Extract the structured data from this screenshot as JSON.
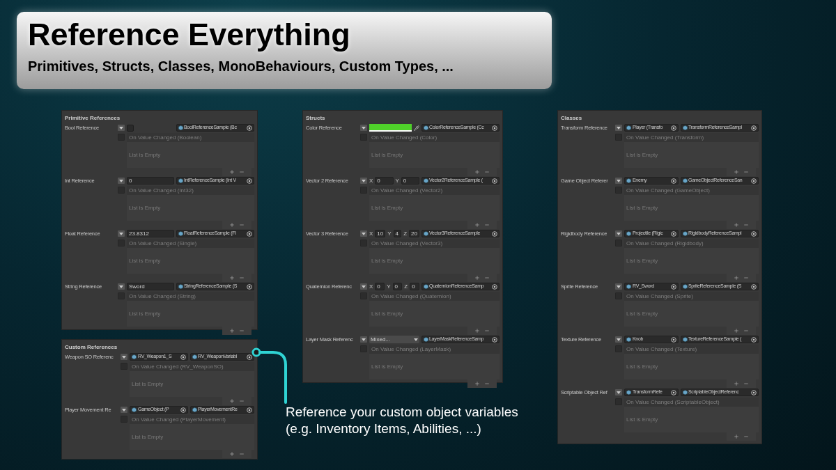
{
  "header": {
    "title": "Reference Everything",
    "subtitle": "Primitives, Structs, Classes, MonoBehaviours, Custom Types, ..."
  },
  "columns": [
    {
      "panels": [
        {
          "title": "Primitive References",
          "entries": [
            {
              "label": "Bool Reference",
              "kind": "bool",
              "checked": false,
              "reference": "BoolReferenceSample (Bc",
              "event": "On Value Changed (Boolean)",
              "empty_text": "List is Empty"
            },
            {
              "label": "Int Reference",
              "kind": "value",
              "value": "0",
              "reference": "IntReferenceSample (Int V",
              "event": "On Value Changed (Int32)",
              "empty_text": "List is Empty"
            },
            {
              "label": "Float Reference",
              "kind": "value",
              "value": "23.8312",
              "reference": "FloatReferenceSample (Fl",
              "event": "On Value Changed (Single)",
              "empty_text": "List is Empty"
            },
            {
              "label": "String Reference",
              "kind": "value",
              "value": "Sword",
              "reference": "StringReferenceSample (S",
              "event": "On Value Changed (String)",
              "empty_text": "List is Empty"
            }
          ]
        },
        {
          "title": "Custom References",
          "entries": [
            {
              "label": "Weapon SO Referenc",
              "kind": "object",
              "value": "RV_Weapon1_S",
              "reference": "RV_WeaponVariabl",
              "event": "On Value Changed (RV_WeaponSO)",
              "empty_text": "List is Empty"
            },
            {
              "label": "Player Movement Re",
              "kind": "object",
              "value": "GameObject (P",
              "reference": "PlayerMovementRe",
              "event": "On Value Changed (PlayerMovement)",
              "empty_text": "List is Empty"
            }
          ]
        }
      ]
    },
    {
      "panels": [
        {
          "title": "Structs",
          "entries": [
            {
              "label": "Color Reference",
              "kind": "color",
              "color": "#4fd12a",
              "reference": "ColorReferenceSample (Cc",
              "event": "On Value Changed (Color)",
              "empty_text": "List is Empty"
            },
            {
              "label": "Vector 2 Reference",
              "kind": "vector",
              "components": [
                {
                  "axis": "X",
                  "value": "0"
                },
                {
                  "axis": "Y",
                  "value": "0"
                }
              ],
              "reference": "Vector2ReferenceSample (",
              "event": "On Value Changed (Vector2)",
              "empty_text": "List is Empty"
            },
            {
              "label": "Vector 3 Reference",
              "kind": "vector",
              "components": [
                {
                  "axis": "X",
                  "value": "10"
                },
                {
                  "axis": "Y",
                  "value": "4"
                },
                {
                  "axis": "Z",
                  "value": "20"
                }
              ],
              "reference": "Vector3ReferenceSample",
              "event": "On Value Changed (Vector3)",
              "empty_text": "List is Empty"
            },
            {
              "label": "Quaternion Referenc",
              "kind": "vector",
              "components": [
                {
                  "axis": "X",
                  "value": "0"
                },
                {
                  "axis": "Y",
                  "value": "0"
                },
                {
                  "axis": "Z",
                  "value": "0"
                }
              ],
              "reference": "QuaternionReferenceSamp",
              "event": "On Value Changed (Quaternion)",
              "empty_text": "List is Empty"
            },
            {
              "label": "Layer Mask Referenc",
              "kind": "dropdown",
              "value": "Mixed...",
              "reference": "LayerMaskReferenceSamp",
              "event": "On Value Changed (LayerMask)",
              "empty_text": "List is Empty"
            }
          ]
        }
      ],
      "callout": {
        "lines": [
          "Reference your custom object variables",
          "(e.g. Inventory Items, Abilities, ...)"
        ]
      }
    },
    {
      "panels": [
        {
          "title": "Classes",
          "entries": [
            {
              "label": "Transform Reference",
              "kind": "object",
              "value": "Player (Transfo",
              "reference": "TransformReferenceSampl",
              "event": "On Value Changed (Transform)",
              "empty_text": "List is Empty"
            },
            {
              "label": "Game Object Referer",
              "kind": "object",
              "value": "Enemy",
              "reference": "GameObjectReferenceSan",
              "event": "On Value Changed (GameObject)",
              "empty_text": "List is Empty"
            },
            {
              "label": "Rigidbody Reference",
              "kind": "object",
              "value": "Projectile (Rigic",
              "reference": "RigidbodyReferenceSampl",
              "event": "On Value Changed (Rigidbody)",
              "empty_text": "List is Empty"
            },
            {
              "label": "Sprite Reference",
              "kind": "object",
              "value": "RV_Sword",
              "reference": "SpriteReferenceSample (S",
              "event": "On Value Changed (Sprite)",
              "empty_text": "List is Empty"
            },
            {
              "label": "Texture Reference",
              "kind": "object",
              "value": "Knob",
              "reference": "TextureReferenceSample (",
              "event": "On Value Changed (Texture)",
              "empty_text": "List is Empty"
            },
            {
              "label": "Scriptable Object Ref",
              "kind": "object",
              "value": "TransformRefe",
              "reference": "ScriptableObjectReferenc",
              "event": "On Value Changed (ScriptableObject)",
              "empty_text": "List is Empty"
            }
          ]
        }
      ]
    }
  ]
}
